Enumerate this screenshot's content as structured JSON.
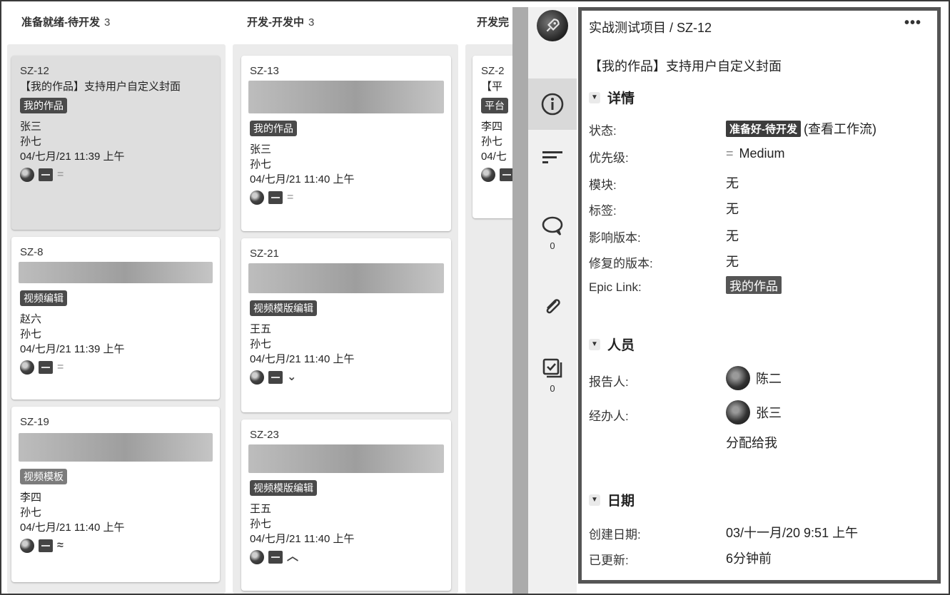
{
  "columns": [
    {
      "name": "准备就绪-待开发",
      "count": "3",
      "cards": [
        {
          "key": "SZ-12",
          "summary": "【我的作品】支持用户自定义封面",
          "label": "我的作品",
          "reporter": "张三",
          "assignee": "孙七",
          "date": "04/七月/21 11:39 上午",
          "priority_icon": "equals-icon",
          "priority": "="
        },
        {
          "key": "SZ-8",
          "summary": "",
          "label": "视频编辑",
          "reporter": "赵六",
          "assignee": "孙七",
          "date": "04/七月/21 11:39 上午",
          "priority_icon": "equals-icon",
          "priority": "="
        },
        {
          "key": "SZ-19",
          "summary": "",
          "label": "视频模板",
          "reporter": "李四",
          "assignee": "孙七",
          "date": "04/七月/21 11:40 上午",
          "priority_icon": "double-up-chevron-icon",
          "priority": "≈"
        }
      ]
    },
    {
      "name": "开发-开发中",
      "count": "3",
      "cards": [
        {
          "key": "SZ-13",
          "summary": "",
          "label": "我的作品",
          "reporter": "张三",
          "assignee": "孙七",
          "date": "04/七月/21 11:40 上午",
          "priority_icon": "equals-icon",
          "priority": "="
        },
        {
          "key": "SZ-21",
          "summary": "",
          "label": "视频模版编辑",
          "reporter": "王五",
          "assignee": "孙七",
          "date": "04/七月/21 11:40 上午",
          "priority_icon": "chevron-down-icon",
          "priority": "⌄"
        },
        {
          "key": "SZ-23",
          "summary": "",
          "label": "视频模版编辑",
          "reporter": "王五",
          "assignee": "孙七",
          "date": "04/七月/21 11:40 上午",
          "priority_icon": "chevron-up-icon",
          "priority": "︿"
        }
      ]
    },
    {
      "name": "开发完",
      "count": "",
      "cards": [
        {
          "key": "SZ-2",
          "summary": "【平",
          "label": "平台",
          "reporter": "李四",
          "assignee": "孙七",
          "date": "04/七"
        }
      ]
    }
  ],
  "toolbar": {
    "comment_count": "0",
    "checklist_count": "0"
  },
  "detail": {
    "breadcrumb": "实战测试项目 / SZ-12",
    "more_label": "•••",
    "summary": "【我的作品】支持用户自定义封面",
    "details_heading": "详情",
    "fields": {
      "status_label": "状态:",
      "status_value": "准备好-待开发",
      "workflow_link": "(查看工作流)",
      "priority_label": "优先级:",
      "priority_value": "Medium",
      "module_label": "模块:",
      "module_value": "无",
      "tags_label": "标签:",
      "tags_value": "无",
      "affects_label": "影响版本:",
      "affects_value": "无",
      "fix_label": "修复的版本:",
      "fix_value": "无",
      "epic_label": "Epic Link:",
      "epic_value": "我的作品"
    },
    "people_heading": "人员",
    "people": {
      "reporter_label": "报告人:",
      "reporter_value": "陈二",
      "assignee_label": "经办人:",
      "assignee_value": "张三",
      "assign_to_me": "分配给我"
    },
    "dates_heading": "日期",
    "dates": {
      "created_label": "创建日期:",
      "created_value": "03/十一月/20 9:51 上午",
      "updated_label": "已更新:",
      "updated_value": "6分钟前"
    }
  }
}
